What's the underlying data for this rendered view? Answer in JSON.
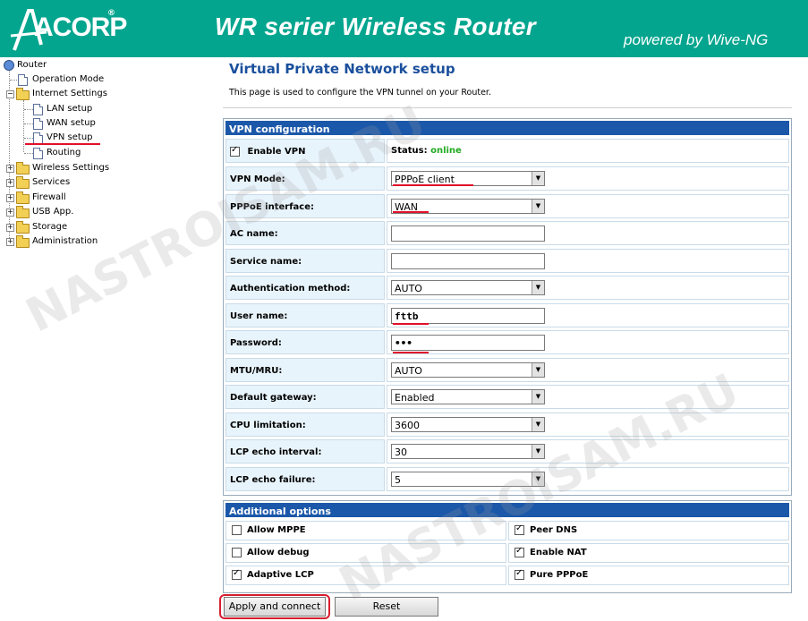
{
  "header": {
    "logo_text": "ACORP",
    "logo_mark": "®",
    "title": "WR serier Wireless Router",
    "powered": "powered by Wive-NG"
  },
  "tree": {
    "root": "Router",
    "items": [
      {
        "label": "Operation Mode"
      },
      {
        "label": "Internet Settings"
      },
      {
        "label": "LAN setup"
      },
      {
        "label": "WAN setup"
      },
      {
        "label": "VPN setup"
      },
      {
        "label": "Routing"
      },
      {
        "label": "Wireless Settings"
      },
      {
        "label": "Services"
      },
      {
        "label": "Firewall"
      },
      {
        "label": "USB App."
      },
      {
        "label": "Storage"
      },
      {
        "label": "Administration"
      }
    ]
  },
  "page": {
    "title": "Virtual Private Network setup",
    "description": "This page is used to configure the VPN tunnel on your Router."
  },
  "vpn": {
    "header": "VPN configuration",
    "enable_label": "Enable VPN",
    "enable_checked": true,
    "status_label": "Status:",
    "status_value": "online",
    "status_color": "#22aa22",
    "rows": [
      {
        "label": "VPN Mode:",
        "kind": "select",
        "value": "PPPoE client"
      },
      {
        "label": "PPPoE interface:",
        "kind": "select",
        "value": "WAN"
      },
      {
        "label": "AC name:",
        "kind": "input",
        "value": ""
      },
      {
        "label": "Service name:",
        "kind": "input",
        "value": ""
      },
      {
        "label": "Authentication method:",
        "kind": "select",
        "value": "AUTO"
      },
      {
        "label": "User name:",
        "kind": "input",
        "value": "fttb"
      },
      {
        "label": "Password:",
        "kind": "input",
        "value": "•••"
      },
      {
        "label": "MTU/MRU:",
        "kind": "select",
        "value": "AUTO"
      },
      {
        "label": "Default gateway:",
        "kind": "select",
        "value": "Enabled"
      },
      {
        "label": "CPU limitation:",
        "kind": "select",
        "value": "3600"
      },
      {
        "label": "LCP echo interval:",
        "kind": "select",
        "value": "30"
      },
      {
        "label": "LCP echo failure:",
        "kind": "select",
        "value": "5"
      }
    ]
  },
  "options": {
    "header": "Additional options",
    "items": [
      {
        "label": "Allow MPPE",
        "checked": false
      },
      {
        "label": "Peer DNS",
        "checked": true
      },
      {
        "label": "Allow debug",
        "checked": false
      },
      {
        "label": "Enable NAT",
        "checked": true
      },
      {
        "label": "Adaptive LCP",
        "checked": true
      },
      {
        "label": "Pure PPPoE",
        "checked": true
      }
    ]
  },
  "buttons": {
    "apply": "Apply and connect",
    "reset": "Reset"
  },
  "watermark": "NASTROISAM.RU",
  "colors": {
    "header_bg": "#04a58e",
    "panel_head": "#1c58a9",
    "title": "#1a4f9c",
    "highlight": "#e0102a"
  }
}
